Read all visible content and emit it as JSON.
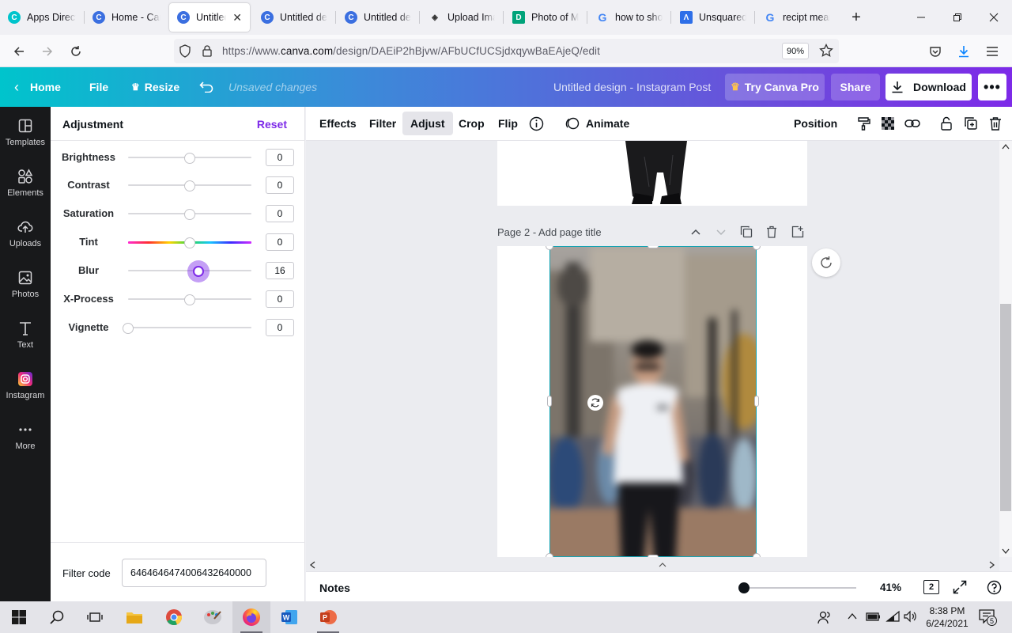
{
  "browser": {
    "tabs": [
      {
        "title": "Apps Directory",
        "icon": "canva-favicon",
        "color": "#00c4cc"
      },
      {
        "title": "Home - Canva",
        "icon": "canva-favicon",
        "color": "#3b6fe0"
      },
      {
        "title": "Untitled design",
        "icon": "canva-favicon",
        "color": "#3b6fe0",
        "active": true
      },
      {
        "title": "Untitled design",
        "icon": "canva-favicon",
        "color": "#3b6fe0"
      },
      {
        "title": "Untitled design",
        "icon": "canva-favicon",
        "color": "#3b6fe0"
      },
      {
        "title": "Upload Image",
        "icon": "layers-favicon",
        "color": "#444"
      },
      {
        "title": "Photo of Man",
        "icon": "d-favicon",
        "color": "#00a37a"
      },
      {
        "title": "how to show",
        "icon": "google-favicon",
        "color": "#4285f4"
      },
      {
        "title": "Unsquared Photos",
        "icon": "app-favicon",
        "color": "#2e6fe8"
      },
      {
        "title": "recipt meaning",
        "icon": "google-favicon",
        "color": "#4285f4"
      }
    ],
    "url_prefix": "https://www.",
    "url_domain": "canva.com",
    "url_path": "/design/DAEiP2hBjvw/AFbUCfUCSjdxqywBaEAjeQ/edit",
    "zoom": "90%"
  },
  "header": {
    "home": "Home",
    "file": "File",
    "resize": "Resize",
    "unsaved": "Unsaved changes",
    "design_title": "Untitled design - Instagram Post",
    "try_pro": "Try Canva Pro",
    "share": "Share",
    "download": "Download"
  },
  "rail": [
    {
      "label": "Templates",
      "icon": "templates-icon"
    },
    {
      "label": "Elements",
      "icon": "elements-icon"
    },
    {
      "label": "Uploads",
      "icon": "uploads-icon"
    },
    {
      "label": "Photos",
      "icon": "photos-icon"
    },
    {
      "label": "Text",
      "icon": "text-icon"
    },
    {
      "label": "Instagram",
      "icon": "instagram-icon"
    },
    {
      "label": "More",
      "icon": "more-icon"
    }
  ],
  "panel": {
    "title": "Adjustment",
    "reset": "Reset",
    "sliders": [
      {
        "label": "Brightness",
        "value": "0",
        "pos": 0.5
      },
      {
        "label": "Contrast",
        "value": "0",
        "pos": 0.5
      },
      {
        "label": "Saturation",
        "value": "0",
        "pos": 0.5
      },
      {
        "label": "Tint",
        "value": "0",
        "pos": 0.5
      },
      {
        "label": "Blur",
        "value": "16",
        "pos": 0.57
      },
      {
        "label": "X-Process",
        "value": "0",
        "pos": 0.5
      },
      {
        "label": "Vignette",
        "value": "0",
        "pos": 0.0
      }
    ],
    "filter_label": "Filter code",
    "filter_code": "6464646474006432640000"
  },
  "toolbar": {
    "effects": "Effects",
    "filter": "Filter",
    "adjust": "Adjust",
    "crop": "Crop",
    "flip": "Flip",
    "animate": "Animate",
    "position": "Position"
  },
  "canvas": {
    "page2_title": "Page 2 - Add page title"
  },
  "bottom": {
    "notes": "Notes",
    "zoom": "41%",
    "page_count": "2"
  },
  "taskbar": {
    "time": "8:38 PM",
    "date": "6/24/2021",
    "notifications": "5"
  }
}
